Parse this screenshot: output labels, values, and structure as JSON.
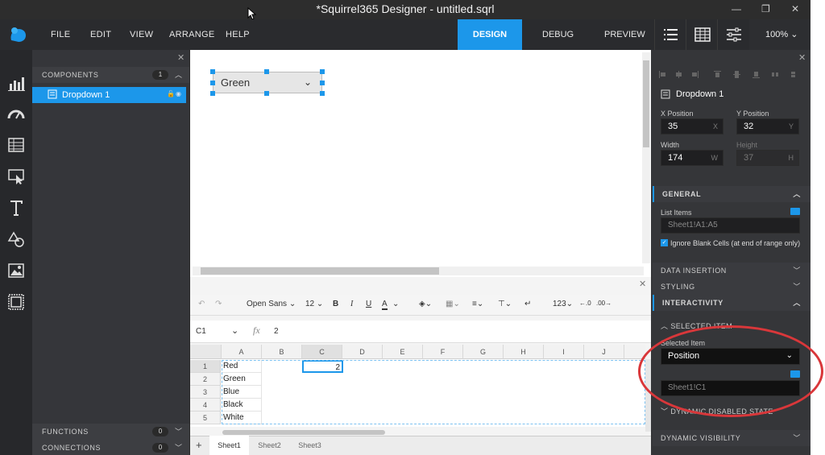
{
  "window": {
    "title": "*Squirrel365 Designer - untitled.sqrl"
  },
  "menu": [
    "FILE",
    "EDIT",
    "VIEW",
    "ARRANGE",
    "HELP"
  ],
  "modes": {
    "design": "DESIGN",
    "debug": "DEBUG",
    "preview": "PREVIEW"
  },
  "zoom": "100%",
  "components": {
    "header": "COMPONENTS",
    "count": "1",
    "item": "Dropdown 1"
  },
  "functions": {
    "label": "FUNCTIONS",
    "count": "0"
  },
  "connections": {
    "label": "CONNECTIONS",
    "count": "0"
  },
  "canvas": {
    "dropdown_value": "Green"
  },
  "toolbar": {
    "font": "Open Sans",
    "size": "12",
    "number_format": "123"
  },
  "formula": {
    "cell_ref": "C1",
    "value": "2"
  },
  "grid": {
    "columns": [
      "A",
      "B",
      "C",
      "D",
      "E",
      "F",
      "G",
      "H",
      "I",
      "J"
    ],
    "rows": [
      "1",
      "2",
      "3",
      "4",
      "5"
    ],
    "colA": [
      "Red",
      "Green",
      "Blue",
      "Black",
      "White"
    ],
    "c1": "2"
  },
  "sheets": [
    "Sheet1",
    "Sheet2",
    "Sheet3"
  ],
  "properties": {
    "name": "Dropdown 1",
    "x_label": "X Position",
    "x_value": "35",
    "x_suffix": "X",
    "y_label": "Y Position",
    "y_value": "32",
    "y_suffix": "Y",
    "w_label": "Width",
    "w_value": "174",
    "w_suffix": "W",
    "h_label": "Height",
    "h_value": "37",
    "h_suffix": "H",
    "general": "GENERAL",
    "list_items_label": "List Items",
    "list_items_value": "Sheet1!A1:A5",
    "ignore_blank": "Ignore Blank Cells (at end of range only)",
    "data_insertion": "DATA INSERTION",
    "styling": "STYLING",
    "interactivity": "INTERACTIVITY",
    "selected_item_section": "SELECTED ITEM",
    "selected_item_label": "Selected Item",
    "selected_item_mode": "Position",
    "selected_item_target": "Sheet1!C1",
    "dynamic_disabled": "DYNAMIC DISABLED STATE",
    "dynamic_visibility": "DYNAMIC VISIBILITY"
  },
  "colors": {
    "accent": "#1c97ea",
    "annotation": "#d9373a"
  }
}
